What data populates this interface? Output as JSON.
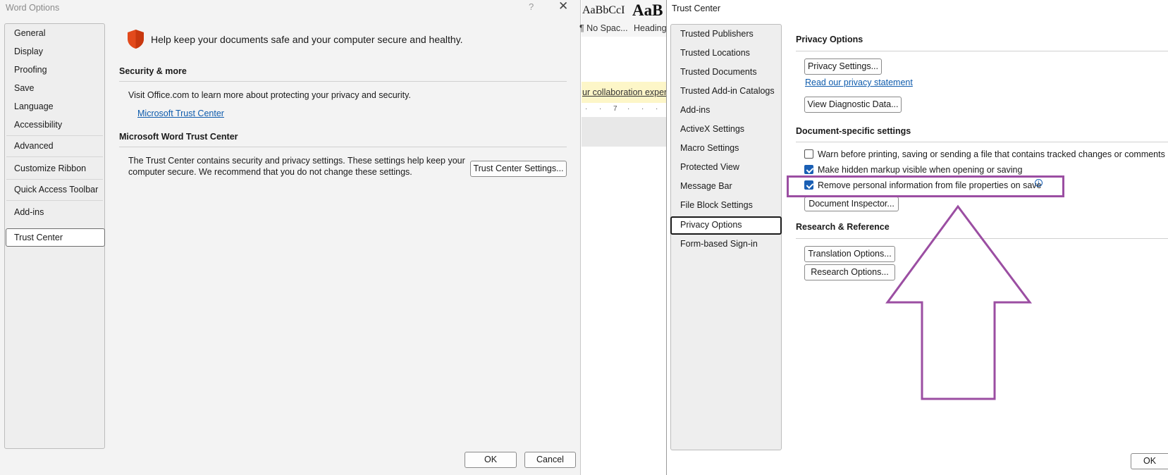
{
  "word_options": {
    "title": "Word Options",
    "help_label": "?",
    "close_label": "✕",
    "nav": [
      "General",
      "Display",
      "Proofing",
      "Save",
      "Language",
      "Accessibility",
      "Advanced",
      "Customize Ribbon",
      "Quick Access Toolbar",
      "Add-ins",
      "Trust Center"
    ],
    "selected_nav": "Trust Center",
    "heading": "Help keep your documents safe and your computer secure and healthy.",
    "security_section": {
      "title": "Security & more",
      "text": "Visit Office.com to learn more about protecting your privacy and security.",
      "link": "Microsoft Trust Center"
    },
    "trust_section": {
      "title": "Microsoft Word Trust Center",
      "text_line1": "The Trust Center contains security and privacy settings. These settings help keep your",
      "text_line2": "computer secure. We recommend that you do not change these settings.",
      "button": "Trust Center Settings..."
    },
    "ok": "OK",
    "cancel": "Cancel"
  },
  "word_background": {
    "style1_sample": "AaBbCcI",
    "style1_label": "¶ No Spac...",
    "style2_sample": "AaB",
    "style2_label": "Heading",
    "banner_text": "ur collaboration experie",
    "ruler_mark": "7"
  },
  "trust_center": {
    "title": "Trust Center",
    "nav": [
      "Trusted Publishers",
      "Trusted Locations",
      "Trusted Documents",
      "Trusted Add-in Catalogs",
      "Add-ins",
      "ActiveX Settings",
      "Macro Settings",
      "Protected View",
      "Message Bar",
      "File Block Settings",
      "Privacy Options",
      "Form-based Sign-in"
    ],
    "selected_nav": "Privacy Options",
    "privacy_options": {
      "title": "Privacy Options",
      "settings_button": "Privacy Settings...",
      "statement_link": "Read our privacy statement",
      "diagnostic_button": "View Diagnostic Data..."
    },
    "document_settings": {
      "title": "Document-specific settings",
      "checkboxes": [
        {
          "label": "Warn before printing, saving or sending a file that contains tracked changes or comments",
          "checked": false
        },
        {
          "label": "Make hidden markup visible when opening or saving",
          "checked": true
        },
        {
          "label": "Remove personal information from file properties on save",
          "checked": true
        }
      ],
      "inspector_button": "Document Inspector..."
    },
    "research": {
      "title": "Research & Reference",
      "translation_button": "Translation Options...",
      "research_button": "Research Options..."
    },
    "ok": "OK"
  },
  "annotation": {
    "highlight_color": "#9b4ea2",
    "arrow_direction": "up"
  },
  "colors": {
    "accent": "#1a5fb4",
    "link": "#0f5cad",
    "shield": "#e24a1c",
    "banner": "#fdf6c8"
  }
}
